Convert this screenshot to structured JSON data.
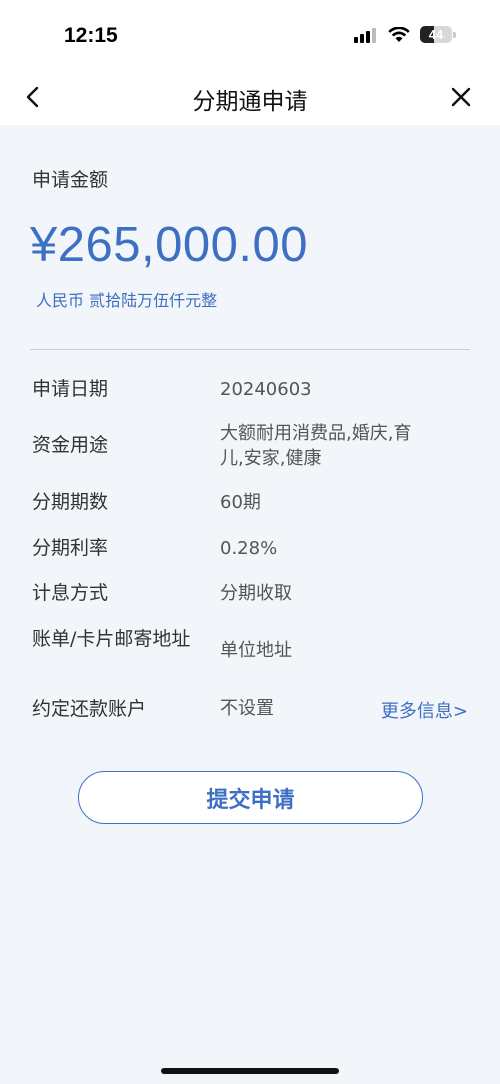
{
  "status_bar": {
    "time": "12:15",
    "battery_level": "44",
    "icons": [
      "signal-icon",
      "wifi-icon",
      "battery-icon"
    ]
  },
  "nav": {
    "title": "分期通申请",
    "back_icon": "chevron-left-icon",
    "close_icon": "close-icon"
  },
  "amount": {
    "label": "申请金额",
    "value": "¥265,000.00",
    "in_words": "人民币 贰拾陆万伍仟元整"
  },
  "details": [
    {
      "label": "申请日期",
      "value": "20240603"
    },
    {
      "label": "资金用途",
      "value": "大额耐用消费品,婚庆,育儿,安家,健康"
    },
    {
      "label": "分期期数",
      "value": "60期"
    },
    {
      "label": "分期利率",
      "value": "0.28%"
    },
    {
      "label": "计息方式",
      "value": "分期收取"
    },
    {
      "label": "账单/卡片邮寄地址",
      "value": "单位地址"
    },
    {
      "label": "约定还款账户",
      "value": "不设置",
      "link": "更多信息>"
    }
  ],
  "submit": {
    "label": "提交申请"
  },
  "colors": {
    "accent": "#3d6fc4",
    "background": "#f2f5f9",
    "header_background": "#ffffff",
    "text_primary": "#333333"
  }
}
